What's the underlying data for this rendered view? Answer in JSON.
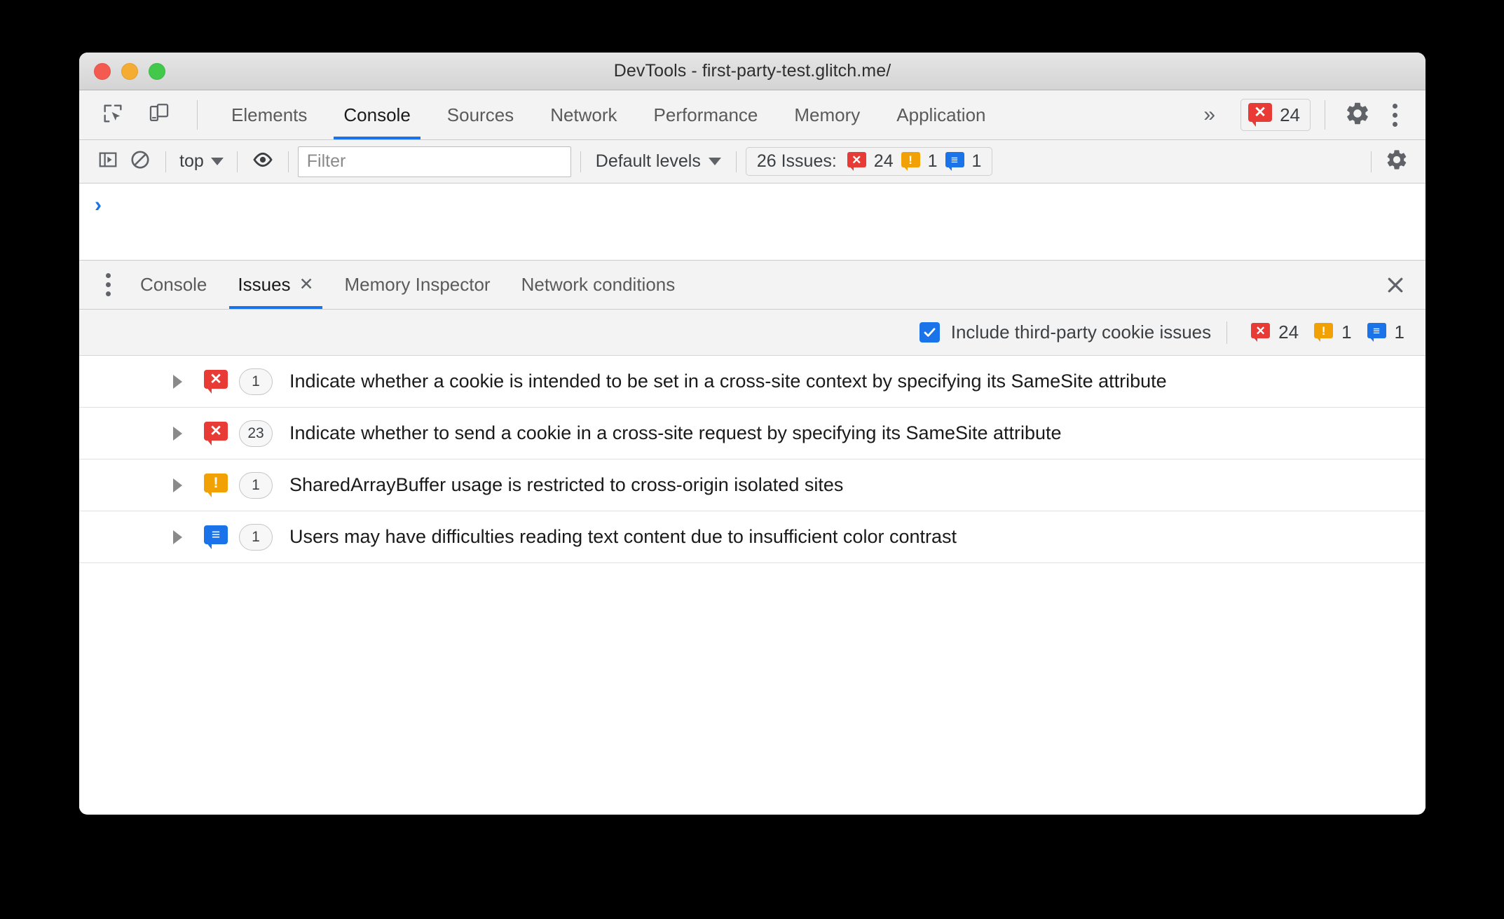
{
  "window": {
    "title": "DevTools - first-party-test.glitch.me/",
    "controls": [
      "close",
      "minimize",
      "zoom"
    ]
  },
  "main_tabbar": {
    "tools": [
      {
        "name": "inspect-element-icon",
        "label": "Inspect element"
      },
      {
        "name": "device-toolbar-icon",
        "label": "Toggle device toolbar"
      }
    ],
    "tabs": [
      {
        "label": "Elements",
        "active": false
      },
      {
        "label": "Console",
        "active": true
      },
      {
        "label": "Sources",
        "active": false
      },
      {
        "label": "Network",
        "active": false
      },
      {
        "label": "Performance",
        "active": false
      },
      {
        "label": "Memory",
        "active": false
      },
      {
        "label": "Application",
        "active": false
      }
    ],
    "overflow_label": "»",
    "error_chip": {
      "icon": "error-bubble-icon",
      "count": "24"
    },
    "settings_label": "Settings",
    "more_label": "Customize and control DevTools"
  },
  "console_toolbar": {
    "sidebar_toggle": "console-sidebar-icon",
    "clear_label": "clear-console-icon",
    "context": "top",
    "eye_label": "live-expression-icon",
    "filter": {
      "value": "",
      "placeholder": "Filter"
    },
    "levels": "Default levels",
    "issues_chip": {
      "label": "26 Issues:",
      "errors": "24",
      "warnings": "1",
      "info": "1"
    },
    "settings_label": "Console settings"
  },
  "console_prompt": {
    "chevron": "›"
  },
  "drawer": {
    "tabs": [
      {
        "label": "Console",
        "active": false,
        "closable": false
      },
      {
        "label": "Issues",
        "active": true,
        "closable": true,
        "close_glyph": "✕"
      },
      {
        "label": "Memory Inspector",
        "active": false,
        "closable": false
      },
      {
        "label": "Network conditions",
        "active": false,
        "closable": false
      }
    ],
    "close_label": "Close drawer",
    "toolbar": {
      "checkbox_label": "Include third-party cookie issues",
      "checkbox_checked": true,
      "errors": "24",
      "warnings": "1",
      "info": "1"
    },
    "issues": [
      {
        "severity": "error",
        "count": "1",
        "text": "Indicate whether a cookie is intended to be set in a cross-site context by specifying its SameSite attribute"
      },
      {
        "severity": "error",
        "count": "23",
        "text": "Indicate whether to send a cookie in a cross-site request by specifying its SameSite attribute"
      },
      {
        "severity": "warning",
        "count": "1",
        "text": "SharedArrayBuffer usage is restricted to cross-origin isolated sites"
      },
      {
        "severity": "info",
        "count": "1",
        "text": "Users may have difficulties reading text content due to insufficient color contrast"
      }
    ]
  },
  "colors": {
    "accent": "#1a73e8",
    "error": "#e83b36",
    "warning": "#f2a104",
    "info": "#1a73e8",
    "toolbar_bg": "#f3f3f3",
    "text": "#3c4043"
  }
}
